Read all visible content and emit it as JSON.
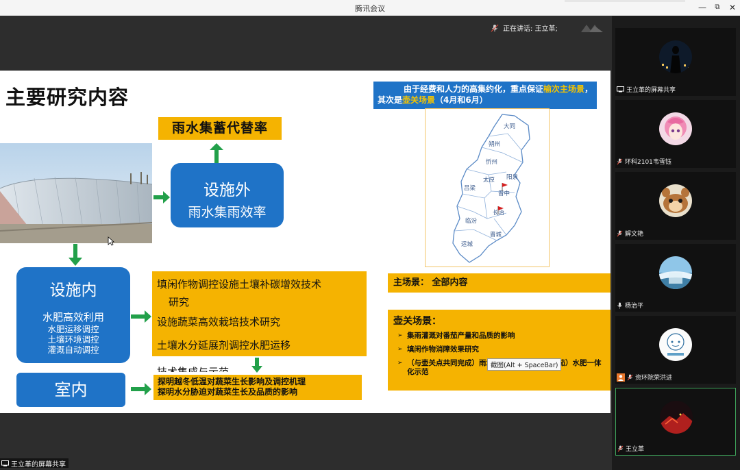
{
  "window": {
    "title": "腾讯会议",
    "minimize": "—",
    "restore": "⧉",
    "close": "✕"
  },
  "header": {
    "speaking_label": "正在讲话: 王立革;"
  },
  "share": {
    "label": "王立革的屏幕共享"
  },
  "slide": {
    "title": "主要研究内容",
    "top_box": "雨水集蓄代替率",
    "outdoor_title": "设施外",
    "outdoor_sub": "雨水集雨效率",
    "indoor_title": "设施内",
    "indoor_lines": [
      "水肥高效利用",
      "水肥运移调控",
      "土壤环境调控",
      "灌溉自动调控"
    ],
    "room_title": "室内",
    "research_items": [
      "填闲作物调控设施土壤补碳增效技术",
      "研究",
      "设施蔬菜高效栽培技术研究",
      "土壤水分延展剂调控水肥运移",
      "技术集成与示范"
    ],
    "room_items": [
      "探明越冬低温对蔬菜生长影响及调控机理",
      "探明水分胁迫对蔬菜生长及品质的影响"
    ],
    "note_prefix": "由于经费和人力的高集约化，重点保证",
    "note_hl1": "榆次主场景",
    "note_mid": "，",
    "note_line2_prefix": "其次是",
    "note_hl2": "壶关场景",
    "note_line2_suffix": "（4月和6月）",
    "map_labels": [
      "大同",
      "朔州",
      "忻州",
      "阳泉",
      "太原",
      "吕梁",
      "晋中",
      "临汾",
      "长治",
      "晋城",
      "运城"
    ],
    "main_scene": "主场景：  全部内容",
    "hg_title": "壶关场景：",
    "hg_items": [
      "集雨灌溉对番茄产量和品质的影响",
      "填闲作物消障效果研究",
      "（与壶关点共同完成）雨水集蓄与高值作物（番茄）水肥一体化示范"
    ],
    "tooltip": "截图(Alt + SpaceBar)"
  },
  "participants": [
    {
      "name": "王立革的屏幕共享",
      "icon": "screen-share-icon",
      "active": false
    },
    {
      "name": "环科2101韦雪钰",
      "icon": "mic-muted-icon",
      "active": false
    },
    {
      "name": "解文艳",
      "icon": "mic-muted-icon",
      "active": false
    },
    {
      "name": "杨治平",
      "icon": "mic-icon",
      "active": false
    },
    {
      "name": "资环院荣洪进",
      "icon": "mic-muted-icon",
      "active": false
    },
    {
      "name": "王立革",
      "icon": "mic-muted-icon",
      "active": true
    }
  ],
  "colors": {
    "accent_blue": "#1f73c7",
    "highlight_yellow": "#f5b301",
    "arrow_green": "#22a04a",
    "note_blue": "#1f73c7",
    "active_border": "#3ea35a"
  }
}
